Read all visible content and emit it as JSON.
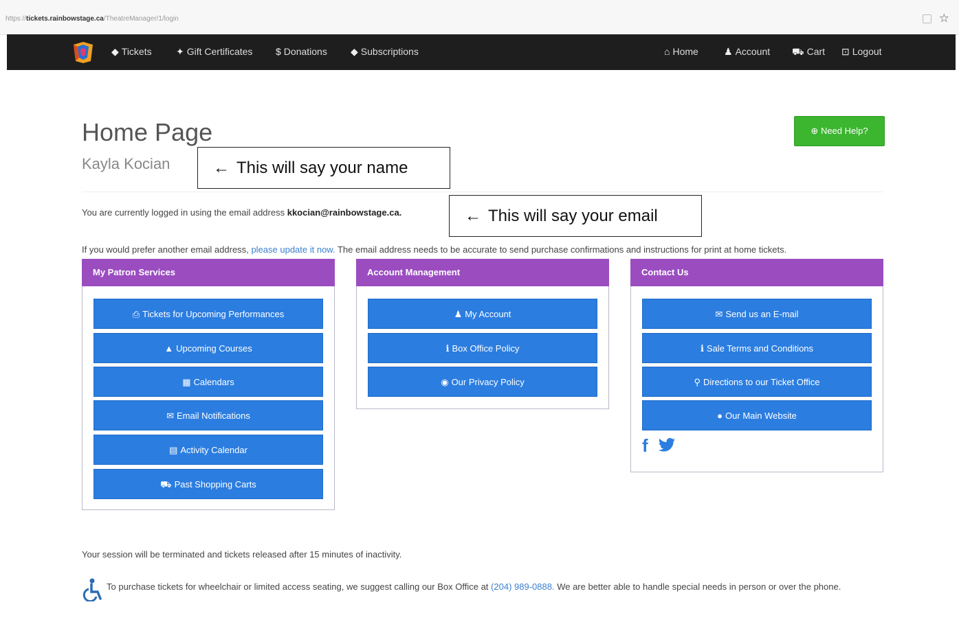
{
  "browser": {
    "url_prefix": "https://",
    "url_host": "tickets.rainbowstage.ca",
    "url_path": "/TheatreManager/1/login",
    "bookmark_icon": "star-icon"
  },
  "navbar": {
    "left": [
      {
        "icon": "tag-icon",
        "label": "Tickets"
      },
      {
        "icon": "gift-icon",
        "label": "Gift Certificates"
      },
      {
        "icon": "dollar-icon",
        "label": "Donations"
      },
      {
        "icon": "tag-icon",
        "label": "Subscriptions"
      }
    ],
    "right": [
      {
        "icon": "home-icon",
        "label": "Home"
      },
      {
        "icon": "user-icon",
        "label": "Account"
      },
      {
        "icon": "cart-icon",
        "label": "Cart"
      },
      {
        "icon": "lock-icon",
        "label": "Logout"
      }
    ]
  },
  "header": {
    "title": "Home Page",
    "user_name": "Kayla Kocian",
    "help_label": "Need Help?"
  },
  "annotations": {
    "name_note": "This will say your name",
    "email_note": "This will say your email"
  },
  "info": {
    "logged_in_prefix": "You are currently logged in using the email address",
    "email": "kkocian@rainbowstage.ca.",
    "prefer_prefix": "If you would prefer another email address,",
    "update_link": "please update it now.",
    "prefer_suffix": "The email address needs to be accurate to send purchase confirmations and instructions for print at home tickets."
  },
  "panels": {
    "patron": {
      "title": "My Patron Services",
      "buttons": [
        {
          "icon": "print-icon",
          "label": "Tickets for Upcoming Performances"
        },
        {
          "icon": "graduation-cap-icon",
          "label": "Upcoming Courses"
        },
        {
          "icon": "calendar-icon",
          "label": "Calendars"
        },
        {
          "icon": "envelope-icon",
          "label": "Email Notifications"
        },
        {
          "icon": "list-icon",
          "label": "Activity Calendar"
        },
        {
          "icon": "cart-icon",
          "label": "Past Shopping Carts"
        }
      ]
    },
    "account": {
      "title": "Account Management",
      "buttons": [
        {
          "icon": "user-icon",
          "label": "My Account"
        },
        {
          "icon": "info-icon",
          "label": "Box Office Policy"
        },
        {
          "icon": "eye-icon",
          "label": "Our Privacy Policy"
        }
      ]
    },
    "contact": {
      "title": "Contact Us",
      "buttons": [
        {
          "icon": "envelope-icon",
          "label": "Send us an E-mail"
        },
        {
          "icon": "info-icon",
          "label": "Sale Terms and Conditions"
        },
        {
          "icon": "map-marker-icon",
          "label": "Directions to our Ticket Office"
        },
        {
          "icon": "globe-icon",
          "label": "Our Main Website"
        }
      ]
    }
  },
  "footer": {
    "session_note": "Your session will be terminated and tickets released after 15 minutes of inactivity.",
    "access_prefix": "To purchase tickets for wheelchair or limited access seating, we suggest calling our Box Office at",
    "phone": "(204) 989-0888.",
    "access_suffix": "We are better able to handle special needs in person or over the phone."
  },
  "colors": {
    "navbar": "#1e1e1e",
    "panel_header": "#9b4dc0",
    "button": "#2b7de0",
    "help_button": "#3cb52f",
    "link": "#3a7fd0"
  }
}
